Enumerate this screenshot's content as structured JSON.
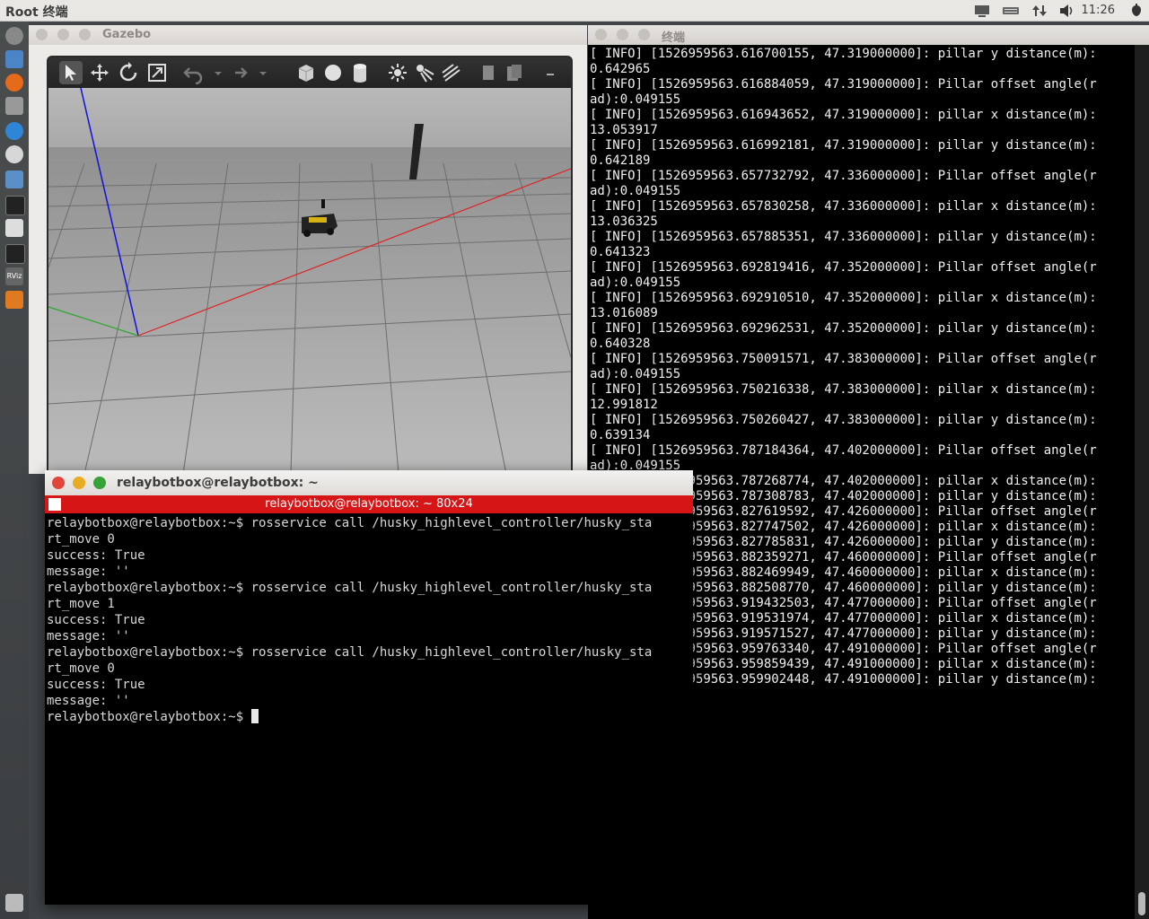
{
  "topbar": {
    "app_title": "Root 终端",
    "clock": "11:26"
  },
  "launcher": {
    "items": [
      "ubuntu-dash-icon",
      "files-icon",
      "firefox-icon",
      "package-icon",
      "rviz-icon",
      "settings-icon",
      "rqt-icon",
      "terminal-icon",
      "editor-icon",
      "terminal-icon",
      "rviz-icon",
      "software-icon",
      "trash-icon"
    ]
  },
  "gazebo": {
    "title": "Gazebo"
  },
  "term_right": {
    "title": "终端",
    "lines": [
      "[ INFO] [1526959563.616700155, 47.319000000]: pillar y distance(m):",
      "0.642965",
      "[ INFO] [1526959563.616884059, 47.319000000]: Pillar offset angle(r",
      "ad):0.049155",
      "[ INFO] [1526959563.616943652, 47.319000000]: pillar x distance(m):",
      "13.053917",
      "[ INFO] [1526959563.616992181, 47.319000000]: pillar y distance(m):",
      "0.642189",
      "[ INFO] [1526959563.657732792, 47.336000000]: Pillar offset angle(r",
      "ad):0.049155",
      "[ INFO] [1526959563.657830258, 47.336000000]: pillar x distance(m):",
      "13.036325",
      "[ INFO] [1526959563.657885351, 47.336000000]: pillar y distance(m):",
      "0.641323",
      "[ INFO] [1526959563.692819416, 47.352000000]: Pillar offset angle(r",
      "ad):0.049155",
      "[ INFO] [1526959563.692910510, 47.352000000]: pillar x distance(m):",
      "13.016089",
      "[ INFO] [1526959563.692962531, 47.352000000]: pillar y distance(m):",
      "0.640328",
      "[ INFO] [1526959563.750091571, 47.383000000]: Pillar offset angle(r",
      "ad):0.049155",
      "[ INFO] [1526959563.750216338, 47.383000000]: pillar x distance(m):",
      "12.991812",
      "[ INFO] [1526959563.750260427, 47.383000000]: pillar y distance(m):",
      "0.639134",
      "[ INFO] [1526959563.787184364, 47.402000000]: Pillar offset angle(r",
      "ad):0.049155",
      "[ INFO] [1526959563.787268774, 47.402000000]: pillar x distance(m):",
      "",
      "[ INFO] [1526959563.787308783, 47.402000000]: pillar y distance(m):",
      "",
      "[ INFO] [1526959563.827619592, 47.426000000]: Pillar offset angle(r",
      "",
      "[ INFO] [1526959563.827747502, 47.426000000]: pillar x distance(m):",
      "",
      "[ INFO] [1526959563.827785831, 47.426000000]: pillar y distance(m):",
      "",
      "[ INFO] [1526959563.882359271, 47.460000000]: Pillar offset angle(r",
      "",
      "[ INFO] [1526959563.882469949, 47.460000000]: pillar x distance(m):",
      "",
      "[ INFO] [1526959563.882508770, 47.460000000]: pillar y distance(m):",
      "",
      "[ INFO] [1526959563.919432503, 47.477000000]: Pillar offset angle(r",
      "",
      "[ INFO] [1526959563.919531974, 47.477000000]: pillar x distance(m):",
      "",
      "[ INFO] [1526959563.919571527, 47.477000000]: pillar y distance(m):",
      "",
      "[ INFO] [1526959563.959763340, 47.491000000]: Pillar offset angle(r",
      "",
      "[ INFO] [1526959563.959859439, 47.491000000]: pillar x distance(m):",
      "",
      "[ INFO] [1526959563.959902448, 47.491000000]: pillar y distance(m):"
    ]
  },
  "term_small": {
    "title": "relaybotbox@relaybotbox: ~",
    "subtitle": "relaybotbox@relaybotbox: ~ 80x24",
    "lines": [
      "relaybotbox@relaybotbox:~$ rosservice call /husky_highlevel_controller/husky_sta",
      "rt_move 0",
      "success: True",
      "message: ''",
      "relaybotbox@relaybotbox:~$ rosservice call /husky_highlevel_controller/husky_sta",
      "rt_move 1",
      "success: True",
      "message: ''",
      "relaybotbox@relaybotbox:~$ rosservice call /husky_highlevel_controller/husky_sta",
      "rt_move 0",
      "success: True",
      "message: ''"
    ],
    "prompt": "relaybotbox@relaybotbox:~$ "
  }
}
